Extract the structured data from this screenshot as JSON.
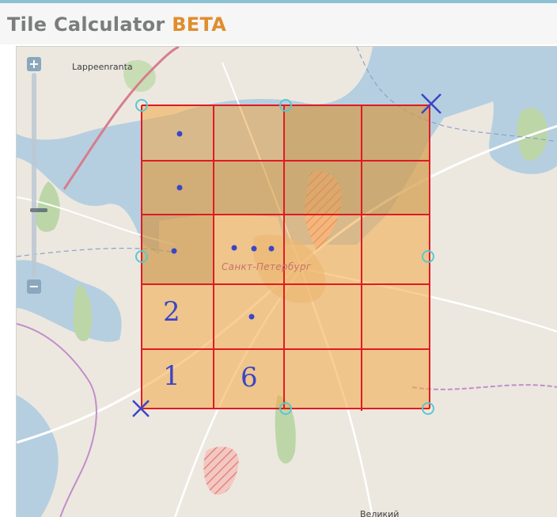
{
  "header": {
    "title": "Tile Calculator",
    "badge": "BETA",
    "title_color": "#7a7c7d",
    "badge_color": "#e08d2e"
  },
  "map": {
    "zoom_in_label": "+",
    "zoom_out_label": "−",
    "places": {
      "lappeenranta": "Lappeenranta",
      "spb": "Санкт-Петербург",
      "velikiy": "Великий"
    },
    "tile_labels": {
      "a": "1",
      "b": "6",
      "c": "2"
    },
    "grid_color": "#e01a24",
    "fill_color": "#f2a845",
    "marker_color": "#3b45c8",
    "handle_color": "#5ac8cf"
  }
}
